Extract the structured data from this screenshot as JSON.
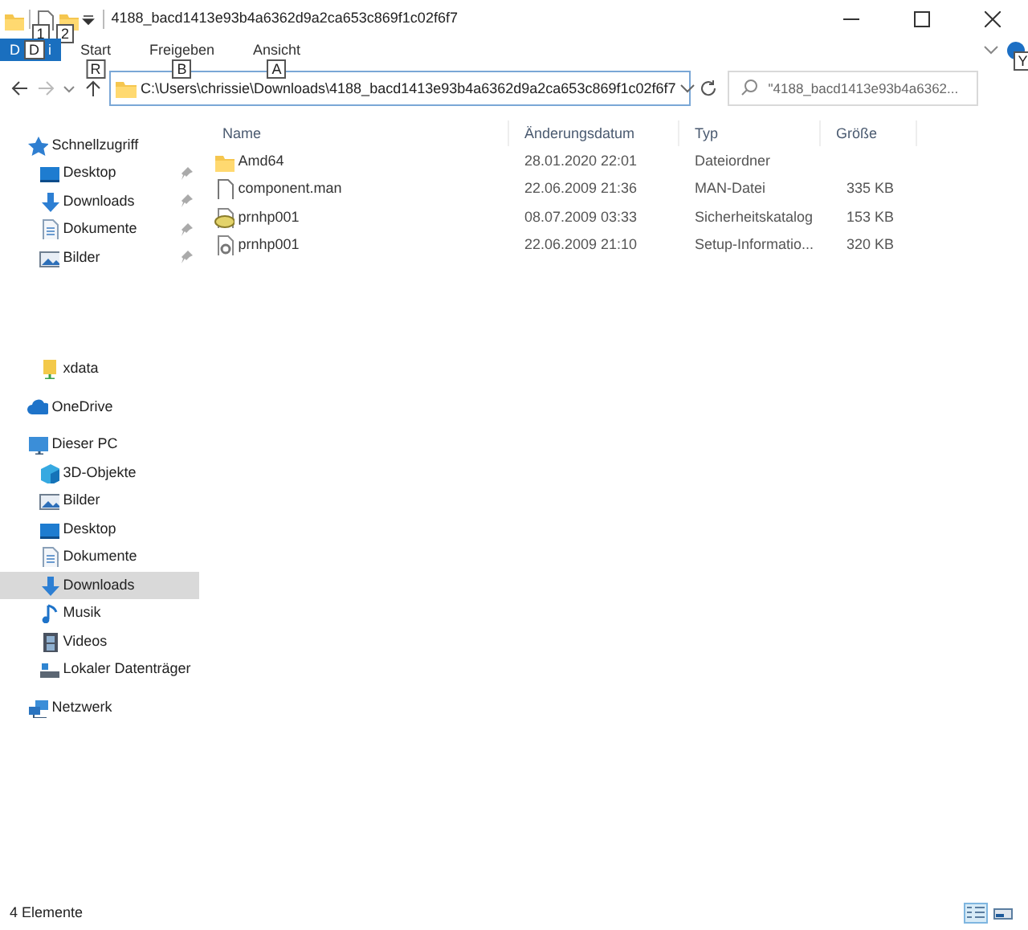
{
  "window": {
    "title": "4188_bacd1413e93b4a6362d9a2ca653c869f1c02f6f7"
  },
  "quick_access": [
    {
      "kind": "folder"
    },
    {
      "kind": "file",
      "keytip": "1"
    },
    {
      "kind": "folder",
      "keytip": "2"
    }
  ],
  "ribbon_tabs": [
    {
      "label": "D",
      "label_end": "i",
      "keytip": "D",
      "selected": true
    },
    {
      "label": "Start",
      "keytip": "R",
      "selected": false
    },
    {
      "label": "Freigeben",
      "keytip": "B",
      "selected": false
    },
    {
      "label": "Ansicht",
      "keytip": "A",
      "selected": false
    }
  ],
  "help_keytip": "Y",
  "address": {
    "path": "C:\\Users\\chrissie\\Downloads\\4188_bacd1413e93b4a6362d9a2ca653c869f1c02f6f7"
  },
  "search": {
    "placeholder": "\"4188_bacd1413e93b4a6362..."
  },
  "sidebar": {
    "items": [
      {
        "label": "Schnellzugriff",
        "selected": false,
        "children": [
          {
            "label": "Desktop",
            "pinned": true,
            "selected": false
          },
          {
            "label": "Downloads",
            "pinned": true,
            "selected": false
          },
          {
            "label": "Dokumente",
            "pinned": true,
            "selected": false
          },
          {
            "label": "Bilder",
            "pinned": true,
            "selected": false
          },
          {
            "label": "xdata",
            "pinned": false,
            "selected": false
          }
        ]
      },
      {
        "label": "OneDrive",
        "selected": false
      },
      {
        "label": "Dieser PC",
        "selected": false,
        "children": [
          {
            "label": "3D-Objekte",
            "selected": false
          },
          {
            "label": "Bilder",
            "selected": false
          },
          {
            "label": "Desktop",
            "selected": false
          },
          {
            "label": "Dokumente",
            "selected": false
          },
          {
            "label": "Downloads",
            "selected": true
          },
          {
            "label": "Musik",
            "selected": false
          },
          {
            "label": "Videos",
            "selected": false
          },
          {
            "label": "Lokaler Datenträger",
            "selected": false
          }
        ]
      },
      {
        "label": "Netzwerk",
        "selected": false
      }
    ]
  },
  "table": {
    "columns": [
      "Name",
      "Änderungsdatum",
      "Typ",
      "Größe"
    ],
    "rows": [
      {
        "kind": "folder",
        "name": "Amd64",
        "date": "28.01.2020 22:01",
        "type": "Dateiordner"
      },
      {
        "kind": "file",
        "name": "component.man",
        "date": "22.06.2009 21:36",
        "type": "MAN-Datei",
        "size": "335 KB"
      },
      {
        "kind": "catalog",
        "name": "prnhp001",
        "date": "08.07.2009 03:33",
        "type": "Sicherheitskatalog",
        "size": "153 KB"
      },
      {
        "kind": "setup",
        "name": "prnhp001",
        "date": "22.06.2009 21:10",
        "type": "Setup-Informatio...",
        "size": "320 KB"
      }
    ]
  },
  "status_bar": {
    "text": "4 Elemente",
    "views": [
      {
        "kind": "details",
        "selected": true
      },
      {
        "kind": "tiles",
        "selected": false
      }
    ]
  }
}
